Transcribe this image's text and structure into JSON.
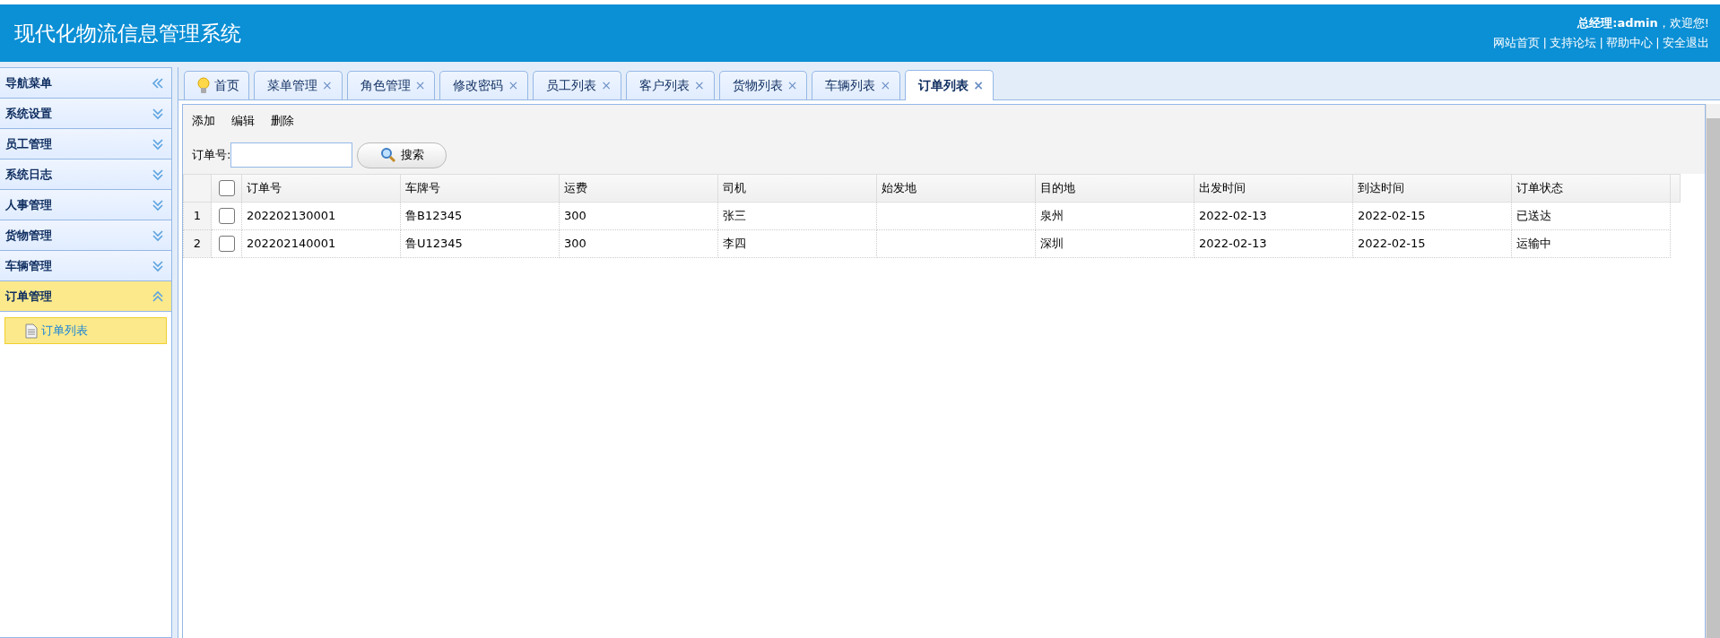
{
  "header": {
    "title": "现代化物流信息管理系统",
    "greeting": "**总经理:admin**，欢迎您!",
    "links": [
      "网站首页",
      "支持论坛",
      "帮助中心",
      "安全退出"
    ],
    "separator": "|"
  },
  "sidebar": {
    "title": "导航菜单",
    "items": [
      {
        "label": "系统设置",
        "expanded": false
      },
      {
        "label": "员工管理",
        "expanded": false
      },
      {
        "label": "系统日志",
        "expanded": false
      },
      {
        "label": "人事管理",
        "expanded": false
      },
      {
        "label": "货物管理",
        "expanded": false
      },
      {
        "label": "车辆管理",
        "expanded": false
      },
      {
        "label": "订单管理",
        "expanded": true,
        "children": [
          {
            "label": "订单列表",
            "selected": true
          }
        ]
      }
    ]
  },
  "tabs": [
    {
      "label": "首页",
      "selected": false,
      "closable": false,
      "kind": "home"
    },
    {
      "label": "菜单管理",
      "selected": false,
      "closable": true,
      "kind": "page"
    },
    {
      "label": "角色管理",
      "selected": false,
      "closable": true,
      "kind": "page"
    },
    {
      "label": "修改密码",
      "selected": false,
      "closable": true,
      "kind": "page"
    },
    {
      "label": "员工列表",
      "selected": false,
      "closable": true,
      "kind": "page"
    },
    {
      "label": "客户列表",
      "selected": false,
      "closable": true,
      "kind": "page"
    },
    {
      "label": "货物列表",
      "selected": false,
      "closable": true,
      "kind": "page"
    },
    {
      "label": "车辆列表",
      "selected": false,
      "closable": true,
      "kind": "page"
    },
    {
      "label": "订单列表",
      "selected": true,
      "closable": true,
      "kind": "page"
    }
  ],
  "close_glyph": "×",
  "toolbar": [
    "添加",
    "编辑",
    "删除"
  ],
  "search": {
    "label": "订单号:",
    "button": "搜索"
  },
  "table": {
    "header_checked": false,
    "columns": [
      "订单号",
      "车牌号",
      "运费",
      "司机",
      "始发地",
      "目的地",
      "出发时间",
      "到达时间",
      "订单状态"
    ],
    "rows": [
      {
        "number": "1",
        "checked": false,
        "cells": [
          "202202130001",
          "鲁B12345",
          "300",
          "张三",
          "",
          "泉州",
          "2022-02-13",
          "2022-02-15",
          "已送达"
        ]
      },
      {
        "number": "2",
        "checked": false,
        "cells": [
          "202202140001",
          "鲁U12345",
          "300",
          "李四",
          "",
          "深圳",
          "2022-02-13",
          "2022-02-15",
          "运输中"
        ]
      }
    ]
  }
}
